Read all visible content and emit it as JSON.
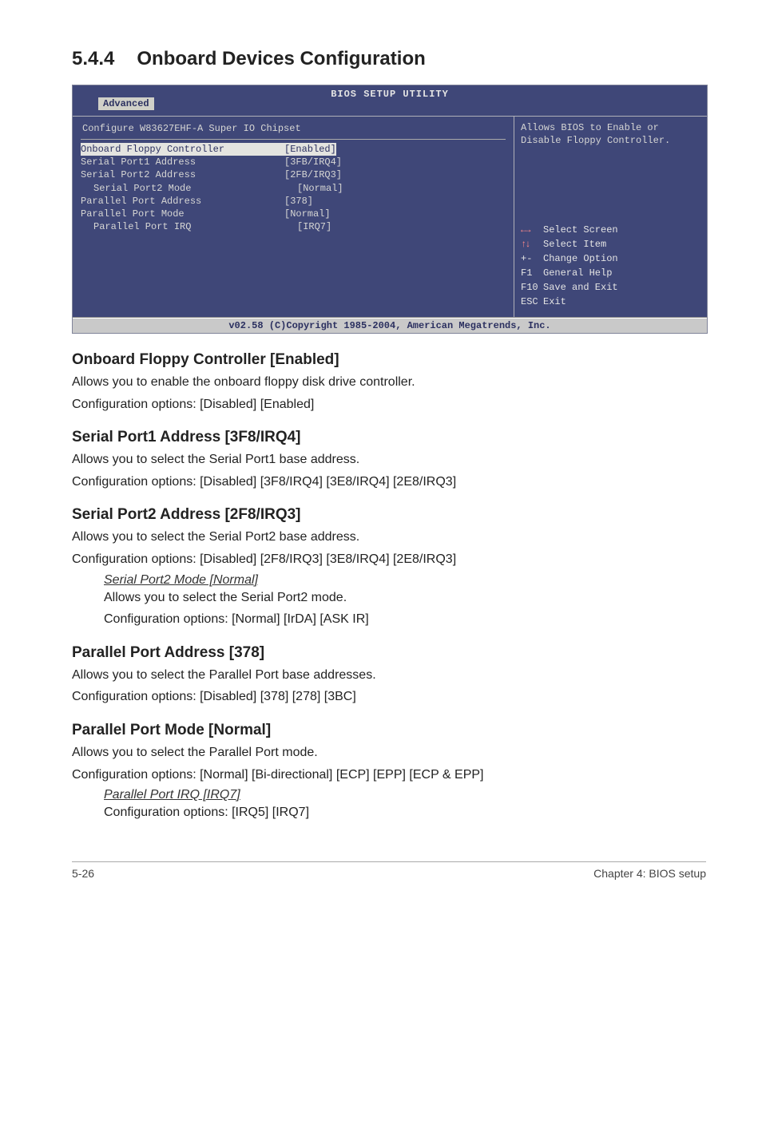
{
  "section": {
    "number": "5.4.4",
    "title": "Onboard Devices Configuration"
  },
  "bios": {
    "title": "BIOS SETUP UTILITY",
    "tab": "Advanced",
    "chipset": "Configure W83627EHF-A Super IO Chipset",
    "rows": [
      {
        "label": "Onboard Floppy Controller",
        "value": "[Enabled]",
        "sel": true,
        "indent": 0
      },
      {
        "label": "Serial Port1 Address",
        "value": "[3FB/IRQ4]",
        "sel": false,
        "indent": 0
      },
      {
        "label": "Serial Port2 Address",
        "value": "[2FB/IRQ3]",
        "sel": false,
        "indent": 0
      },
      {
        "label": "Serial Port2 Mode",
        "value": "[Normal]",
        "sel": false,
        "indent": 1
      },
      {
        "label": "Parallel Port Address",
        "value": "[378]",
        "sel": false,
        "indent": 0
      },
      {
        "label": "Parallel Port Mode",
        "value": "[Normal]",
        "sel": false,
        "indent": 0
      },
      {
        "label": "Parallel Port IRQ",
        "value": "[IRQ7]",
        "sel": false,
        "indent": 1
      }
    ],
    "help_top": "Allows BIOS to Enable or Disable Floppy Controller.",
    "keys": {
      "select_screen": "Select Screen",
      "select_item": "Select Item",
      "change_key": "+-",
      "change_label": "Change Option",
      "f1": "F1",
      "f1_label": "General Help",
      "f10": "F10",
      "f10_label": "Save and Exit",
      "esc": "ESC",
      "esc_label": "Exit"
    },
    "footer": "v02.58 (C)Copyright 1985-2004, American Megatrends, Inc."
  },
  "fields": {
    "floppy": {
      "heading": "Onboard Floppy Controller [Enabled]",
      "p1": "Allows you to enable the onboard floppy disk drive controller.",
      "p2": "Configuration options: [Disabled] [Enabled]"
    },
    "sp1": {
      "heading": "Serial Port1 Address [3F8/IRQ4]",
      "p1": "Allows you to select the Serial Port1 base address.",
      "p2": "Configuration options: [Disabled] [3F8/IRQ4] [3E8/IRQ4] [2E8/IRQ3]"
    },
    "sp2": {
      "heading": "Serial Port2 Address [2F8/IRQ3]",
      "p1": "Allows you to select the Serial Port2 base address.",
      "p2": "Configuration options: [Disabled] [2F8/IRQ3] [3E8/IRQ4] [2E8/IRQ3]",
      "sub_head": "Serial Port2 Mode [Normal]",
      "sub_p1": "Allows you to select the Serial Port2 mode.",
      "sub_p2": "Configuration options: [Normal] [IrDA] [ASK IR]"
    },
    "ppa": {
      "heading": "Parallel Port Address [378]",
      "p1": "Allows you to select the Parallel Port base addresses.",
      "p2": "Configuration options: [Disabled] [378] [278] [3BC]"
    },
    "ppm": {
      "heading": "Parallel Port Mode [Normal]",
      "p1": "Allows you to select the Parallel Port mode.",
      "p2": "Configuration options: [Normal] [Bi-directional] [ECP] [EPP] [ECP & EPP]",
      "sub_head": "Parallel Port IRQ [IRQ7]",
      "sub_p1": "Configuration options: [IRQ5] [IRQ7]"
    }
  },
  "footer": {
    "left": "5-26",
    "right": "Chapter 4: BIOS setup"
  }
}
